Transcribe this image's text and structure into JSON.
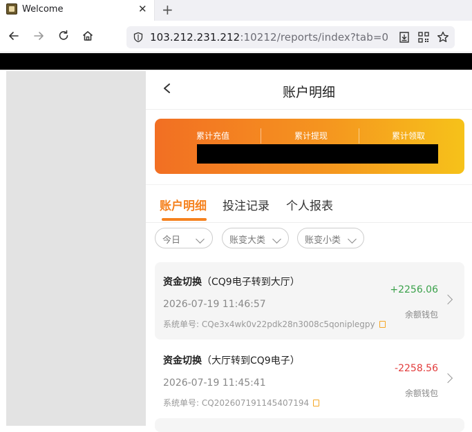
{
  "browser": {
    "tab_title": "Welcome",
    "url_host": "103.212.231.212",
    "url_rest": ":10212/reports/index?tab=0"
  },
  "page": {
    "title": "账户明细"
  },
  "stats": {
    "labels": [
      "累计充值",
      "累计提现",
      "累计领取"
    ]
  },
  "tabs": {
    "items": [
      "账户明细",
      "投注记录",
      "个人报表"
    ],
    "active_index": 0
  },
  "filters": {
    "items": [
      "今日",
      "账变大类",
      "账变小类"
    ]
  },
  "records": [
    {
      "type": "资金切换",
      "detail": "（CQ9电子转到大厅）",
      "time": "2026-07-19 11:46:57",
      "order_label": "系统单号:",
      "order_no": "CQe3x4wk0v22pdk28n3008c5qoniplegpy",
      "amount": "+2256.06",
      "wallet": "余额钱包"
    },
    {
      "type": "资金切换",
      "detail": "（大厅转到CQ9电子）",
      "time": "2026-07-19 11:45:41",
      "order_label": "系统单号:",
      "order_no": "CQ202607191145407194",
      "amount": "-2258.56",
      "wallet": "余额钱包"
    }
  ],
  "colors": {
    "accent": "#f5821f",
    "positive": "#3aa14a",
    "negative": "#e23b3b"
  }
}
